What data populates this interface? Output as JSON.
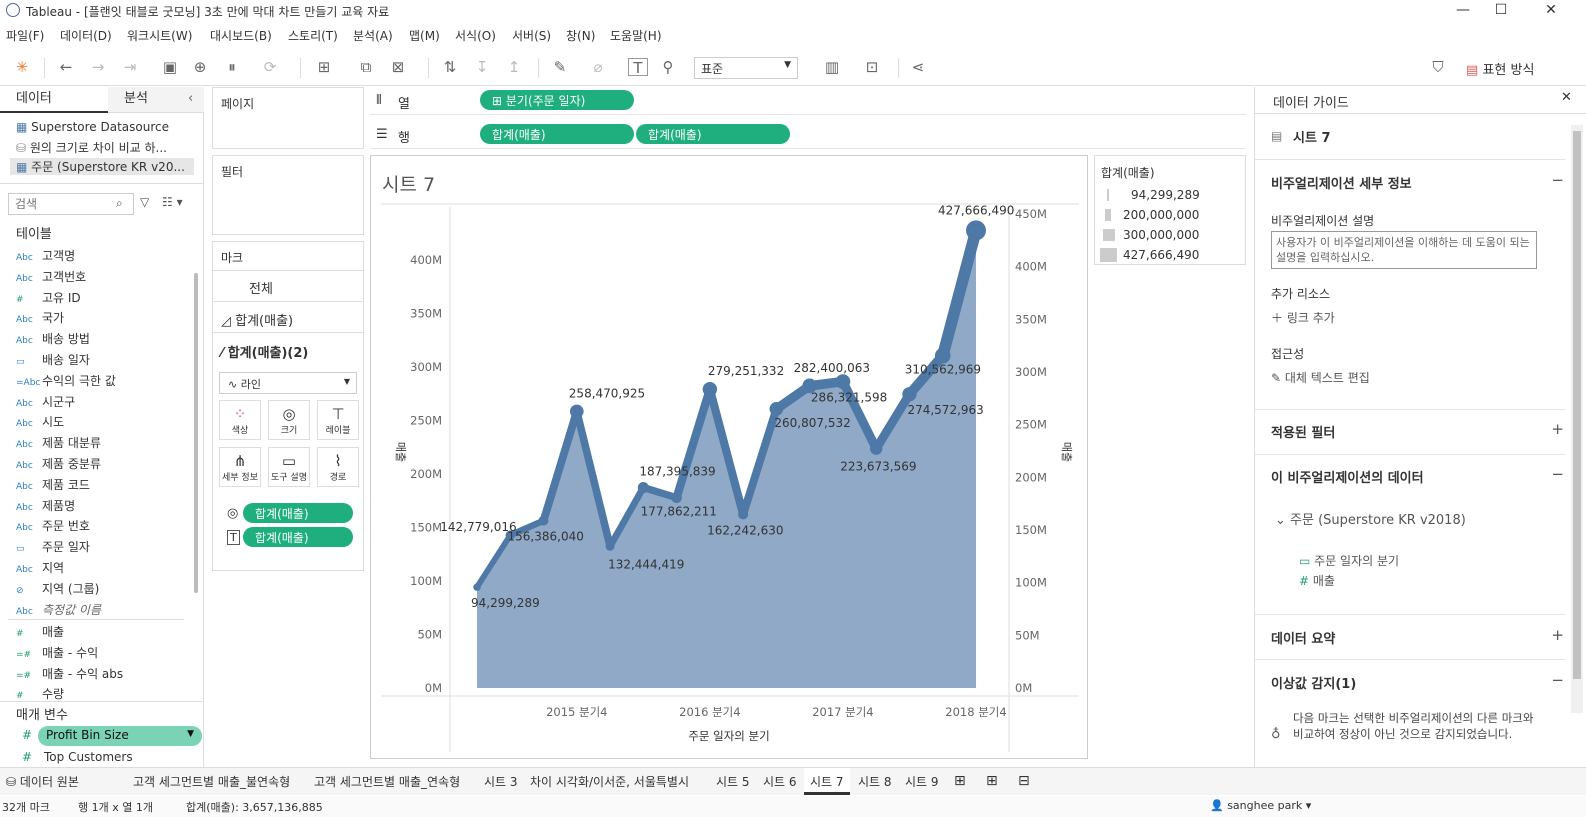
{
  "window": {
    "title": "Tableau - [플랜잇 태블로 굿모닝] 3초 만에 막대 차트 만들기 교육 자료",
    "minimize": "—",
    "maximize": "☐",
    "close": "✕"
  },
  "menu": [
    "파일(F)",
    "데이터(D)",
    "워크시트(W)",
    "대시보드(B)",
    "스토리(T)",
    "분석(A)",
    "맵(M)",
    "서식(O)",
    "서버(S)",
    "창(N)",
    "도움말(H)"
  ],
  "toolbar": {
    "fit": "표준",
    "show_me": "표현 방식"
  },
  "data_pane": {
    "tab_data": "데이터",
    "tab_analysis": "분석",
    "sources": [
      "Superstore Datasource",
      "원의 크기로 차이 비교 하...",
      "주문 (Superstore KR v20..."
    ],
    "search_placeholder": "검색",
    "tables_header": "테이블",
    "fields": [
      {
        "icon": "Abc",
        "name": "고객명"
      },
      {
        "icon": "Abc",
        "name": "고객번호"
      },
      {
        "icon": "#",
        "name": "고유 ID"
      },
      {
        "icon": "Abc",
        "name": "국가"
      },
      {
        "icon": "Abc",
        "name": "배송 방법"
      },
      {
        "icon": "▭",
        "name": "배송 일자"
      },
      {
        "icon": "=Abc",
        "name": "수익의 극한 값"
      },
      {
        "icon": "Abc",
        "name": "시군구"
      },
      {
        "icon": "Abc",
        "name": "시도"
      },
      {
        "icon": "Abc",
        "name": "제품 대분류"
      },
      {
        "icon": "Abc",
        "name": "제품 중분류"
      },
      {
        "icon": "Abc",
        "name": "제품 코드"
      },
      {
        "icon": "Abc",
        "name": "제품명"
      },
      {
        "icon": "Abc",
        "name": "주문 번호"
      },
      {
        "icon": "▭",
        "name": "주문 일자"
      },
      {
        "icon": "Abc",
        "name": "지역"
      },
      {
        "icon": "⊘",
        "name": "지역 (그룹)"
      },
      {
        "icon": "Abc",
        "name": "측정값 이름"
      }
    ],
    "measures": [
      {
        "icon": "#",
        "name": "매출"
      },
      {
        "icon": "=#",
        "name": "매출 - 수익"
      },
      {
        "icon": "=#",
        "name": "매출 - 수익 abs"
      },
      {
        "icon": "#",
        "name": "수량"
      }
    ],
    "params_header": "매개 변수",
    "params": [
      {
        "icon": "#",
        "name": "Profit Bin Size"
      },
      {
        "icon": "#",
        "name": "Top Customers"
      }
    ]
  },
  "shelves": {
    "pages": "페이지",
    "filters": "필터",
    "marks": "마크",
    "all": "전체",
    "mark1": "합계(매출)",
    "mark2": "합계(매출)(2)",
    "mark_type": "라인",
    "btn_color": "색상",
    "btn_size": "크기",
    "btn_label": "레이블",
    "btn_detail": "세부 정보",
    "btn_tooltip": "도구 설명",
    "btn_path": "경로",
    "mark_pill1": "합계(매출)",
    "mark_pill2": "합계(매출)",
    "columns_label": "열",
    "rows_label": "행",
    "col_pill": "분기(주문 일자)",
    "row_pill1": "합계(매출)",
    "row_pill2": "합계(매출)"
  },
  "sheet_title": "시트 7",
  "legend": {
    "title": "합계(매출)",
    "items": [
      "94,299,289",
      "200,000,000",
      "300,000,000",
      "427,666,490"
    ]
  },
  "chart_data": {
    "type": "area",
    "title": "시트 7",
    "xlabel": "주문 일자의 분기",
    "ylabel": "매출",
    "ylabel_right": "매출",
    "ylim": [
      0,
      450000000
    ],
    "yticks": [
      "0M",
      "50M",
      "100M",
      "150M",
      "200M",
      "250M",
      "300M",
      "350M",
      "400M"
    ],
    "yticks_right": [
      "0M",
      "50M",
      "100M",
      "150M",
      "200M",
      "250M",
      "300M",
      "350M",
      "400M",
      "450M"
    ],
    "x_ticks": [
      "2015 분기4",
      "2016 분기4",
      "2017 분기4",
      "2018 분기4"
    ],
    "series": [
      {
        "name": "합계(매출)",
        "values": [
          94299289,
          142779016,
          156386040,
          258470925,
          132444419,
          187395839,
          177862211,
          279251332,
          162242630,
          260807532,
          282400063,
          286321598,
          223673569,
          274572963,
          310562969,
          427666490
        ]
      }
    ],
    "labels": [
      "94,299,289",
      "142,779,016",
      "156,386,040",
      "258,470,925",
      "132,444,419",
      "187,395,839",
      "177,862,211",
      "279,251,332",
      "162,242,630",
      "260,807,532",
      "282,400,063",
      "286,321,598",
      "223,673,569",
      "274,572,963",
      "310,562,969",
      "427,666,490"
    ],
    "colors": {
      "line": "#4e79a7",
      "area": "#8fa9c7"
    }
  },
  "guide": {
    "title": "데이터 가이드",
    "sheet": "시트 7",
    "viz_details": "비주얼리제이션 세부 정보",
    "desc_label": "비주얼리제이션 설명",
    "desc_placeholder": "사용자가 이 비주얼리제이션을 이해하는 데 도움이 되는 설명을 입력하십시오.",
    "resources": "추가 리소스",
    "add_link": "링크 추가",
    "access": "접근성",
    "alt_text": "대체 텍스트 편집",
    "filters": "적용된 필터",
    "viz_data": "이 비주얼리제이션의 데이터",
    "source": "주문 (Superstore KR v2018)",
    "field1": "주문 일자의 분기",
    "field2": "매출",
    "summary": "데이터 요약",
    "outlier": "이상값 감지(1)",
    "outlier_text": "다음 마크는 선택한 비주얼리제이션의 다른 마크와 비교하여 정상이 아닌 것으로 감지되었습니다."
  },
  "tabs": [
    "데이터 원본",
    "고객 세그먼트별 매출_불연속형",
    "고객 세그먼트별 매출_연속형",
    "시트 3",
    "차이 시각화/이서준, 서울특별시",
    "시트 5",
    "시트 6",
    "시트 7",
    "시트 8",
    "시트 9"
  ],
  "status": {
    "marks": "32개 마크",
    "rows": "행 1개 x 열 1개",
    "sum": "합계(매출): 3,657,136,885",
    "user": "sanghee park"
  }
}
